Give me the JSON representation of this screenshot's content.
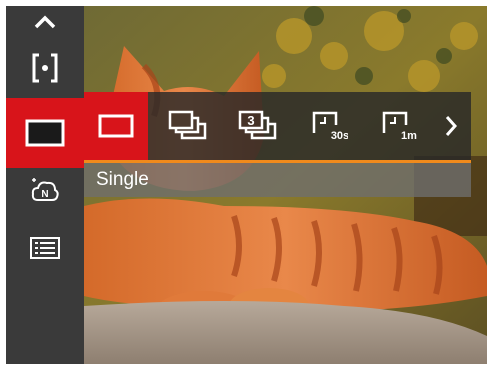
{
  "colors": {
    "menu_bg": "#3a3a3a",
    "selection_red": "#d8141a",
    "accent_orange": "#f08a1c",
    "label_bar_bg": "#6e6e6e",
    "icon_white": "#ffffff"
  },
  "left_menu": {
    "items": [
      {
        "name": "scroll-up",
        "icon": "chevron-up-icon"
      },
      {
        "name": "metering",
        "icon": "spot-metering-icon"
      },
      {
        "name": "drive-mode",
        "icon": "single-frame-icon",
        "selected": true
      },
      {
        "name": "scene",
        "icon": "scene-n-icon"
      },
      {
        "name": "menu",
        "icon": "menu-list-icon"
      }
    ]
  },
  "drive_options": {
    "items": [
      {
        "name": "single",
        "icon": "single-frame-icon",
        "selected": true
      },
      {
        "name": "continuous",
        "icon": "continuous-shot-icon"
      },
      {
        "name": "burst-3",
        "icon": "burst-3-icon",
        "badge": "3"
      },
      {
        "name": "timer-30s",
        "icon": "self-timer-icon",
        "badge": "30s"
      },
      {
        "name": "timer-1m",
        "icon": "self-timer-icon",
        "badge": "1m"
      },
      {
        "name": "next",
        "icon": "chevron-right-icon"
      }
    ],
    "selected_label": "Single"
  }
}
